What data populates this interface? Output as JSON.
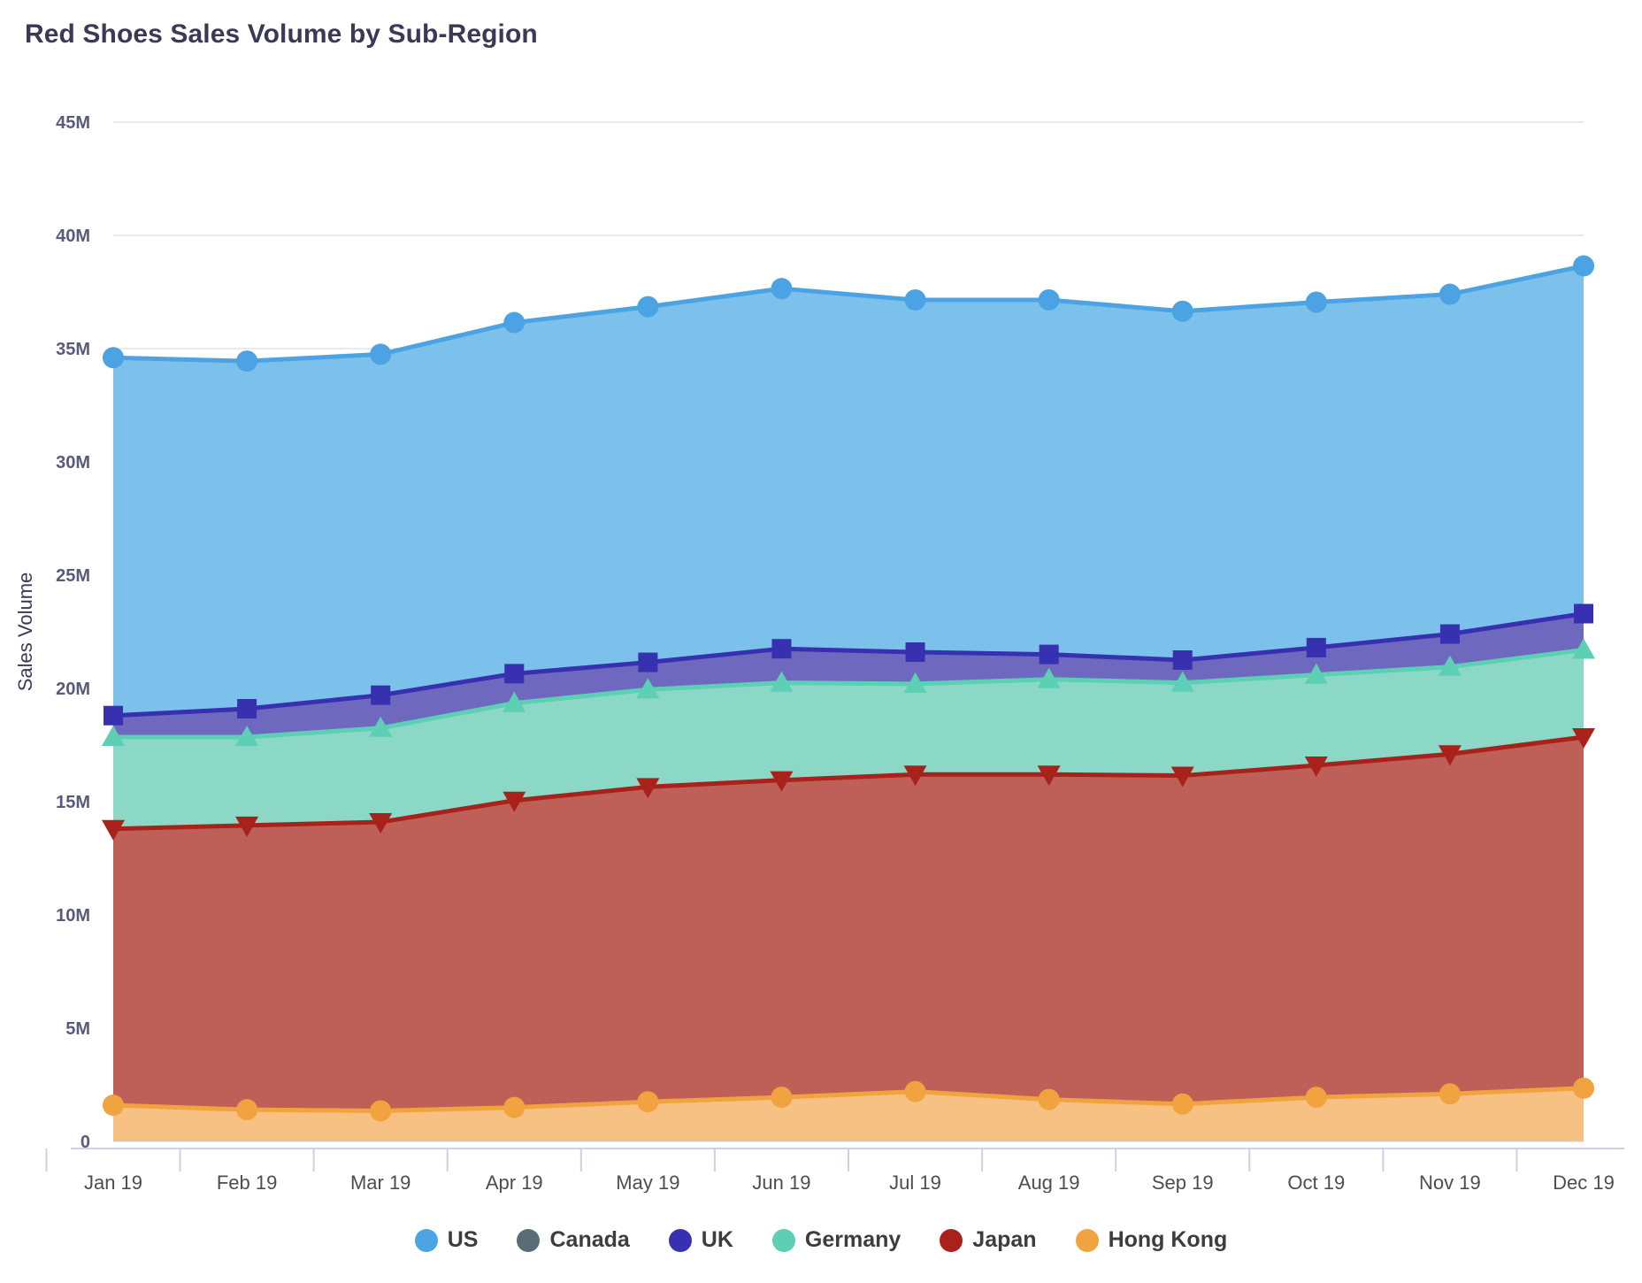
{
  "header": {
    "title": "Red Shoes Sales Volume by Sub-Region"
  },
  "legend": {
    "items": [
      {
        "label": "US",
        "color": "#4BA3E3",
        "marker": "circle"
      },
      {
        "label": "Canada",
        "color": "#5A6C75",
        "marker": "circle"
      },
      {
        "label": "UK",
        "color": "#3730B0",
        "marker": "square"
      },
      {
        "label": "Germany",
        "color": "#5CCFB4",
        "marker": "triangle-up"
      },
      {
        "label": "Japan",
        "color": "#A8221B",
        "marker": "triangle-down"
      },
      {
        "label": "Hong Kong",
        "color": "#F0A33F",
        "marker": "circle"
      }
    ]
  },
  "axes": {
    "y_title": "Sales Volume",
    "y_ticks": [
      "0",
      "5M",
      "10M",
      "15M",
      "20M",
      "25M",
      "30M",
      "35M",
      "40M",
      "45M"
    ],
    "x_ticks": [
      "Jan 19",
      "Feb 19",
      "Mar 19",
      "Apr 19",
      "May 19",
      "Jun 19",
      "Jul 19",
      "Aug 19",
      "Sep 19",
      "Oct 19",
      "Nov 19",
      "Dec 19"
    ]
  },
  "chart_data": {
    "type": "area",
    "stacked": true,
    "title": "Red Shoes Sales Volume by Sub-Region",
    "xlabel": "",
    "ylabel": "Sales Volume",
    "ylim": [
      0,
      46
    ],
    "y_unit": "millions",
    "grid": true,
    "legend_position": "bottom",
    "categories": [
      "Jan 19",
      "Feb 19",
      "Mar 19",
      "Apr 19",
      "May 19",
      "Jun 19",
      "Jul 19",
      "Aug 19",
      "Sep 19",
      "Oct 19",
      "Nov 19",
      "Dec 19"
    ],
    "series": [
      {
        "name": "Hong Kong",
        "color": "#F0A33F",
        "fill": "#F7C183",
        "marker": "circle",
        "values": [
          1.6,
          1.4,
          1.35,
          1.5,
          1.75,
          1.95,
          2.2,
          1.85,
          1.65,
          1.95,
          2.1,
          2.35
        ]
      },
      {
        "name": "Japan",
        "color": "#A8221B",
        "fill": "#BE6058",
        "marker": "triangle-down",
        "cumulative": [
          13.8,
          13.95,
          14.1,
          15.05,
          15.65,
          15.95,
          16.2,
          16.2,
          16.15,
          16.6,
          17.1,
          17.85
        ],
        "values": [
          12.2,
          12.55,
          12.75,
          13.55,
          13.9,
          14.0,
          14.0,
          14.35,
          14.5,
          14.65,
          15.0,
          15.5
        ]
      },
      {
        "name": "Germany",
        "color": "#5CCFB4",
        "fill": "#8AD8C5",
        "marker": "triangle-up",
        "cumulative": [
          17.85,
          17.85,
          18.25,
          19.35,
          19.95,
          20.25,
          20.2,
          20.4,
          20.25,
          20.6,
          20.95,
          21.7
        ],
        "values": [
          4.05,
          3.9,
          4.15,
          4.3,
          4.3,
          4.3,
          4.0,
          4.2,
          4.1,
          4.0,
          3.85,
          3.85
        ]
      },
      {
        "name": "UK",
        "color": "#3730B0",
        "fill": "#6E69BE",
        "marker": "square",
        "cumulative": [
          18.8,
          19.1,
          19.7,
          20.65,
          21.15,
          21.75,
          21.6,
          21.5,
          21.25,
          21.8,
          22.4,
          23.3
        ],
        "values": [
          0.95,
          1.25,
          1.45,
          1.3,
          1.2,
          1.5,
          1.4,
          1.1,
          1.0,
          1.2,
          1.45,
          1.6
        ]
      },
      {
        "name": "Canada",
        "color": "#5A6C75",
        "fill": "#5A6C75",
        "marker": "circle",
        "cumulative": [
          18.8,
          19.1,
          19.7,
          20.65,
          21.15,
          21.75,
          21.6,
          21.5,
          21.25,
          21.8,
          22.4,
          23.3
        ],
        "values": [
          0,
          0,
          0,
          0,
          0,
          0,
          0,
          0,
          0,
          0,
          0,
          0
        ]
      },
      {
        "name": "US",
        "color": "#4BA3E3",
        "fill": "#7CC1EC",
        "marker": "circle",
        "cumulative": [
          34.6,
          34.45,
          34.75,
          36.15,
          36.85,
          37.65,
          37.15,
          37.15,
          36.65,
          37.05,
          37.4,
          38.65
        ],
        "values": [
          15.8,
          15.35,
          15.05,
          15.5,
          15.7,
          15.9,
          15.55,
          15.65,
          15.4,
          15.25,
          15.0,
          15.35
        ]
      }
    ]
  }
}
